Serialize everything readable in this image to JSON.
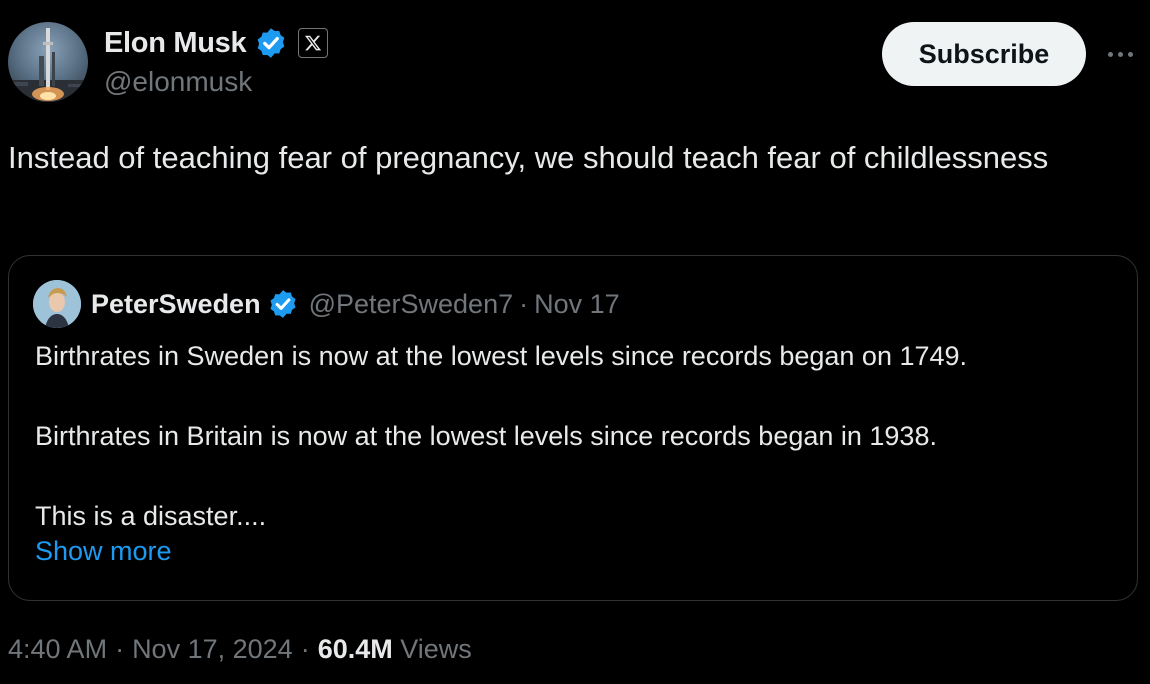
{
  "author": {
    "display_name": "Elon Musk",
    "handle": "@elonmusk",
    "verified_color": "#1d9bf0",
    "affiliate_badge": "X"
  },
  "actions": {
    "subscribe_label": "Subscribe",
    "more_icon": "more-horizontal-icon"
  },
  "tweet": {
    "text": "Instead of teaching fear of pregnancy, we should teach fear of childlessness"
  },
  "quote": {
    "display_name": "PeterSweden",
    "handle": "@PeterSweden7",
    "separator": "·",
    "date": "Nov 17",
    "paragraphs": [
      "Birthrates in Sweden is now at the lowest levels since records began on 1749.",
      "Birthrates in Britain is now at the lowest levels since records began in 1938.",
      "This is a disaster...."
    ],
    "show_more": "Show more"
  },
  "meta": {
    "time": "4:40 AM",
    "sep1": "·",
    "date": "Nov 17, 2024",
    "sep2": "·",
    "views_count": "60.4M",
    "views_label": "Views"
  },
  "colors": {
    "background": "#000000",
    "primary_text": "#e7e9ea",
    "secondary_text": "#71767b",
    "link": "#1d9bf0",
    "border": "#2f3336",
    "button_bg": "#eff3f4"
  }
}
